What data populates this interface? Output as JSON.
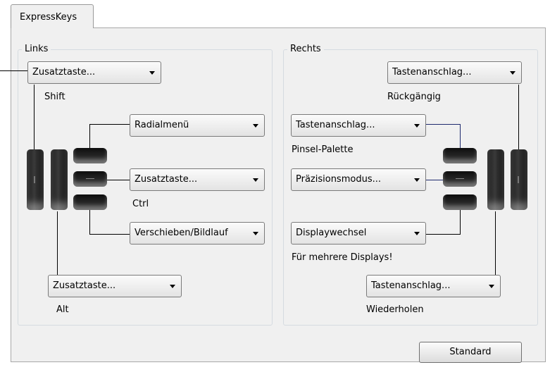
{
  "tabs": [
    {
      "label": "ExpressKeys"
    }
  ],
  "left": {
    "title": "Links",
    "dropdowns": {
      "top": {
        "value": "Zusatztaste...",
        "caption": "Shift"
      },
      "k1": {
        "value": "Radialmenü"
      },
      "k2": {
        "value": "Zusatztaste...",
        "caption": "Ctrl"
      },
      "k3": {
        "value": "Verschieben/Bildlauf"
      },
      "bottom": {
        "value": "Zusatztaste...",
        "caption": "Alt"
      }
    }
  },
  "right": {
    "title": "Rechts",
    "dropdowns": {
      "top": {
        "value": "Tastenanschlag...",
        "caption": "Rückgängig"
      },
      "k1": {
        "value": "Tastenanschlag...",
        "caption": "Pinsel-Palette"
      },
      "k2": {
        "value": "Präzisionsmodus..."
      },
      "k3": {
        "value": "Displaywechsel",
        "caption": "Für mehrere Displays!"
      },
      "bottom": {
        "value": "Tastenanschlag...",
        "caption": "Wiederholen"
      }
    }
  },
  "buttons": {
    "standard": "Standard"
  }
}
